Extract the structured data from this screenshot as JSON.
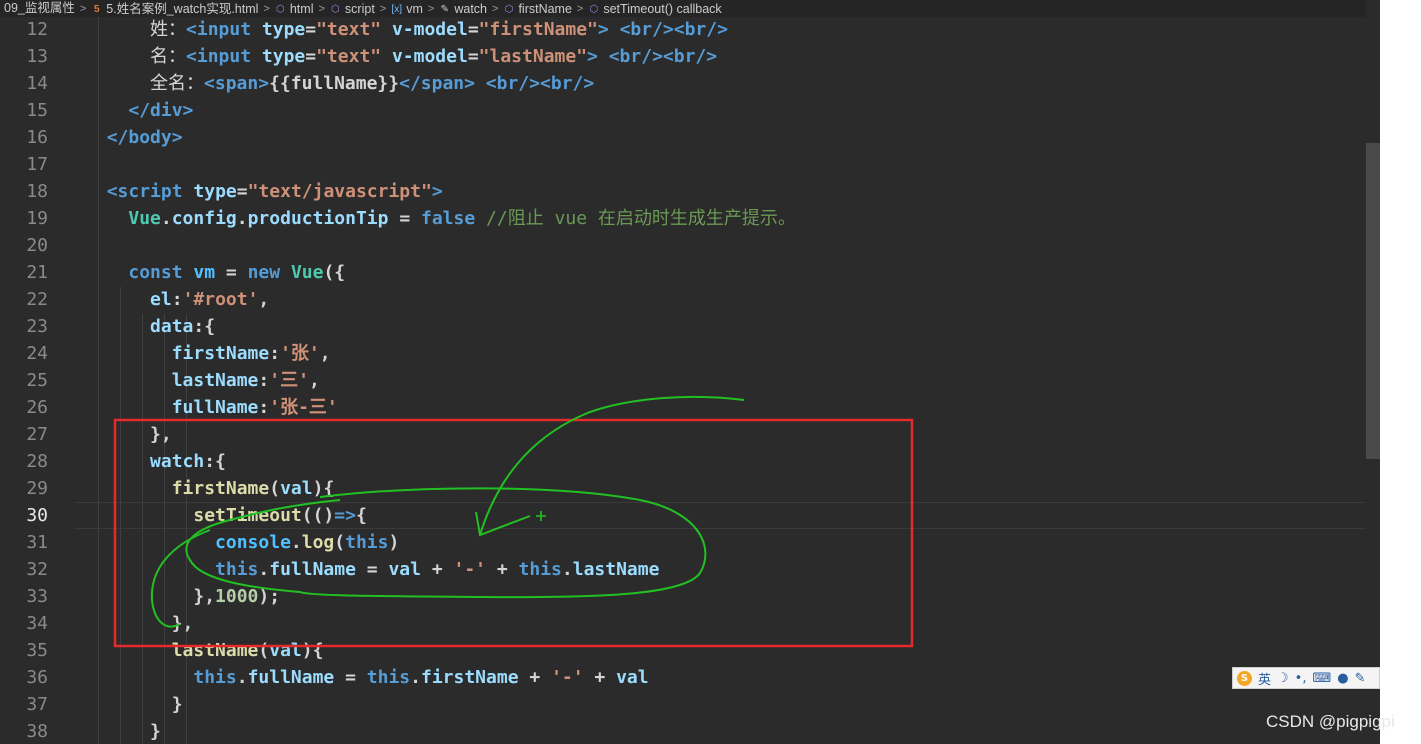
{
  "breadcrumb": {
    "items": [
      {
        "label": "09_监视属性",
        "icon": ""
      },
      {
        "label": "5.姓名案例_watch实现.html",
        "icon": "html5-icon"
      },
      {
        "label": "html",
        "icon": "cube-icon"
      },
      {
        "label": "script",
        "icon": "cube-icon"
      },
      {
        "label": "vm",
        "icon": "variable-icon"
      },
      {
        "label": "watch",
        "icon": "wrench-icon"
      },
      {
        "label": "firstName",
        "icon": "cube-icon"
      },
      {
        "label": "setTimeout() callback",
        "icon": "cube-icon"
      }
    ]
  },
  "editor": {
    "current_line": "30",
    "lines": [
      {
        "n": "12",
        "tokens": [
          [
            "txt",
            "      "
          ],
          [
            "cn txt",
            "姓："
          ],
          [
            "tag",
            "<input "
          ],
          [
            "attr",
            "type"
          ],
          [
            "txt",
            "="
          ],
          [
            "str",
            "\"text\""
          ],
          [
            "attr",
            " v-model"
          ],
          [
            "txt",
            "="
          ],
          [
            "str",
            "\"firstName\""
          ],
          [
            "tag",
            "> <br/><br/>"
          ]
        ]
      },
      {
        "n": "13",
        "tokens": [
          [
            "txt",
            "      "
          ],
          [
            "cn txt",
            "名："
          ],
          [
            "tag",
            "<input "
          ],
          [
            "attr",
            "type"
          ],
          [
            "txt",
            "="
          ],
          [
            "str",
            "\"text\""
          ],
          [
            "attr",
            " v-model"
          ],
          [
            "txt",
            "="
          ],
          [
            "str",
            "\"lastName\""
          ],
          [
            "tag",
            "> <br/><br/>"
          ]
        ]
      },
      {
        "n": "14",
        "tokens": [
          [
            "txt",
            "      "
          ],
          [
            "cn txt",
            "全名："
          ],
          [
            "tag",
            "<span>"
          ],
          [
            "txt",
            "{{fullName}}"
          ],
          [
            "tag",
            "</span> <br/><br/>"
          ]
        ]
      },
      {
        "n": "15",
        "tokens": [
          [
            "txt",
            "    "
          ],
          [
            "tag",
            "</div>"
          ]
        ]
      },
      {
        "n": "16",
        "tokens": [
          [
            "txt",
            "  "
          ],
          [
            "tag",
            "</body>"
          ]
        ]
      },
      {
        "n": "17",
        "tokens": []
      },
      {
        "n": "18",
        "tokens": [
          [
            "txt",
            "  "
          ],
          [
            "tag",
            "<script "
          ],
          [
            "attr",
            "type"
          ],
          [
            "txt",
            "="
          ],
          [
            "str",
            "\"text/javascript\""
          ],
          [
            "tag",
            ">"
          ]
        ]
      },
      {
        "n": "19",
        "tokens": [
          [
            "txt",
            "    "
          ],
          [
            "cls",
            "Vue"
          ],
          [
            "txt",
            "."
          ],
          [
            "prop",
            "config"
          ],
          [
            "txt",
            "."
          ],
          [
            "prop",
            "productionTip"
          ],
          [
            "txt",
            " = "
          ],
          [
            "kw",
            "false"
          ],
          [
            "cmt",
            " //阻止 vue 在启动时生成生产提示。"
          ]
        ]
      },
      {
        "n": "20",
        "tokens": []
      },
      {
        "n": "21",
        "tokens": [
          [
            "txt",
            "    "
          ],
          [
            "kw",
            "const"
          ],
          [
            "txt",
            " "
          ],
          [
            "var",
            "vm"
          ],
          [
            "txt",
            " = "
          ],
          [
            "kw",
            "new"
          ],
          [
            "txt",
            " "
          ],
          [
            "cls",
            "Vue"
          ],
          [
            "txt",
            "({"
          ]
        ]
      },
      {
        "n": "22",
        "tokens": [
          [
            "txt",
            "      "
          ],
          [
            "prop",
            "el"
          ],
          [
            "txt",
            ":"
          ],
          [
            "str",
            "'#root'"
          ],
          [
            "txt",
            ","
          ]
        ]
      },
      {
        "n": "23",
        "tokens": [
          [
            "txt",
            "      "
          ],
          [
            "prop",
            "data"
          ],
          [
            "txt",
            ":{"
          ]
        ]
      },
      {
        "n": "24",
        "tokens": [
          [
            "txt",
            "        "
          ],
          [
            "prop",
            "firstName"
          ],
          [
            "txt",
            ":"
          ],
          [
            "str",
            "'张'"
          ],
          [
            "txt",
            ","
          ]
        ]
      },
      {
        "n": "25",
        "tokens": [
          [
            "txt",
            "        "
          ],
          [
            "prop",
            "lastName"
          ],
          [
            "txt",
            ":"
          ],
          [
            "str",
            "'三'"
          ],
          [
            "txt",
            ","
          ]
        ]
      },
      {
        "n": "26",
        "tokens": [
          [
            "txt",
            "        "
          ],
          [
            "prop",
            "fullName"
          ],
          [
            "txt",
            ":"
          ],
          [
            "str",
            "'张-三'"
          ]
        ]
      },
      {
        "n": "27",
        "tokens": [
          [
            "txt",
            "      },"
          ]
        ]
      },
      {
        "n": "28",
        "tokens": [
          [
            "txt",
            "      "
          ],
          [
            "prop",
            "watch"
          ],
          [
            "txt",
            ":{"
          ]
        ]
      },
      {
        "n": "29",
        "tokens": [
          [
            "txt",
            "        "
          ],
          [
            "fn",
            "firstName"
          ],
          [
            "txt",
            "("
          ],
          [
            "attr",
            "val"
          ],
          [
            "txt",
            "){"
          ]
        ]
      },
      {
        "n": "30",
        "tokens": [
          [
            "txt",
            "          "
          ],
          [
            "fn",
            "setTimeout"
          ],
          [
            "txt",
            "(()"
          ],
          [
            "kw",
            "=>"
          ],
          [
            "txt",
            "{"
          ]
        ]
      },
      {
        "n": "31",
        "tokens": [
          [
            "txt",
            "            "
          ],
          [
            "var",
            "console"
          ],
          [
            "txt",
            "."
          ],
          [
            "fn",
            "log"
          ],
          [
            "txt",
            "("
          ],
          [
            "kw",
            "this"
          ],
          [
            "txt",
            ")"
          ]
        ]
      },
      {
        "n": "32",
        "tokens": [
          [
            "txt",
            "            "
          ],
          [
            "kw",
            "this"
          ],
          [
            "txt",
            "."
          ],
          [
            "prop",
            "fullName"
          ],
          [
            "txt",
            " = "
          ],
          [
            "attr",
            "val"
          ],
          [
            "txt",
            " + "
          ],
          [
            "str",
            "'-'"
          ],
          [
            "txt",
            " + "
          ],
          [
            "kw",
            "this"
          ],
          [
            "txt",
            "."
          ],
          [
            "prop",
            "lastName"
          ]
        ]
      },
      {
        "n": "33",
        "tokens": [
          [
            "txt",
            "          },"
          ],
          [
            "num",
            "1000"
          ],
          [
            "txt",
            ");"
          ]
        ]
      },
      {
        "n": "34",
        "tokens": [
          [
            "txt",
            "        },"
          ]
        ]
      },
      {
        "n": "35",
        "tokens": [
          [
            "txt",
            "        "
          ],
          [
            "fn",
            "lastName"
          ],
          [
            "txt",
            "("
          ],
          [
            "attr",
            "val"
          ],
          [
            "txt",
            "){"
          ]
        ]
      },
      {
        "n": "36",
        "tokens": [
          [
            "txt",
            "          "
          ],
          [
            "kw",
            "this"
          ],
          [
            "txt",
            "."
          ],
          [
            "prop",
            "fullName"
          ],
          [
            "txt",
            " = "
          ],
          [
            "kw",
            "this"
          ],
          [
            "txt",
            "."
          ],
          [
            "prop",
            "firstName"
          ],
          [
            "txt",
            " + "
          ],
          [
            "str",
            "'-'"
          ],
          [
            "txt",
            " + "
          ],
          [
            "attr",
            "val"
          ]
        ]
      },
      {
        "n": "37",
        "tokens": [
          [
            "txt",
            "        }"
          ]
        ]
      },
      {
        "n": "38",
        "tokens": [
          [
            "txt",
            "      }"
          ]
        ]
      }
    ]
  },
  "ime_bar": {
    "lang_label": "英",
    "icons": [
      "sogou-logo-icon",
      "moon-icon",
      "punctuation-icon",
      "keyboard-icon",
      "user-icon",
      "wrench-icon"
    ]
  },
  "watermark": "CSDN @pigpigpi",
  "annotation": {
    "box_color": "#e32b2b",
    "scribble_color": "#22c022"
  }
}
